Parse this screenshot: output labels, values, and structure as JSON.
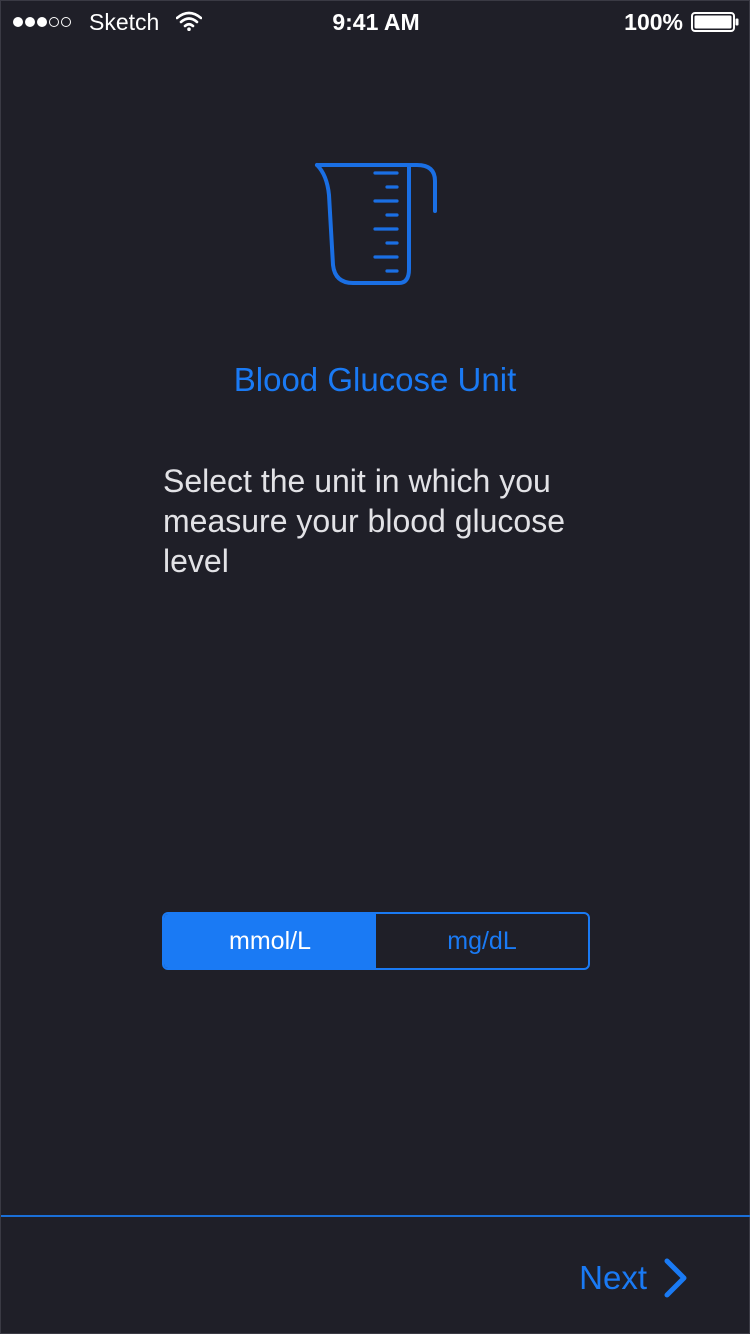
{
  "status_bar": {
    "signal_dots_filled": 3,
    "signal_dots_total": 5,
    "carrier": "Sketch",
    "wifi_icon": "wifi-icon",
    "time": "9:41 AM",
    "battery_percent": "100%",
    "battery_icon": "battery-icon",
    "battery_level": 1.0
  },
  "main": {
    "icon": "measuring-cup-icon",
    "title": "Blood Glucose Unit",
    "description": "Select the unit in which you measure your blood glucose level"
  },
  "unit_selector": {
    "options": [
      {
        "label": "mmol/L",
        "selected": true
      },
      {
        "label": "mg/dL",
        "selected": false
      }
    ]
  },
  "footer": {
    "next_label": "Next",
    "next_icon": "chevron-right-icon"
  },
  "colors": {
    "background": "#1f1f28",
    "accent": "#1a7af4",
    "text": "#e2e2e6"
  }
}
